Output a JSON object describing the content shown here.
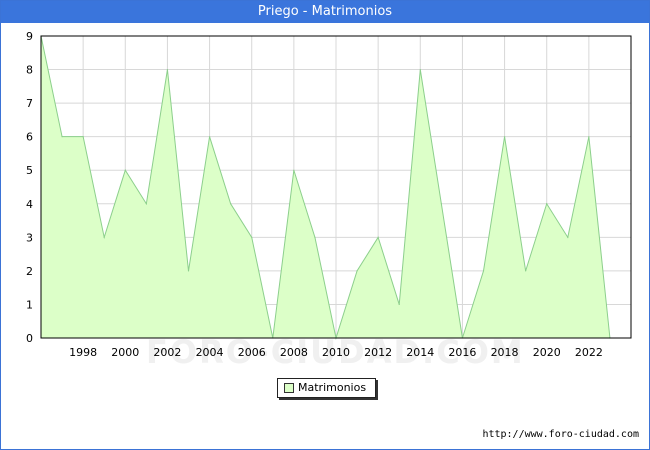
{
  "chart_data": {
    "type": "area",
    "title": "Priego - Matrimonios",
    "xlabel": "",
    "ylabel": "",
    "x": [
      1996,
      1997,
      1998,
      1999,
      2000,
      2001,
      2002,
      2003,
      2004,
      2005,
      2006,
      2007,
      2008,
      2009,
      2010,
      2011,
      2012,
      2013,
      2014,
      2015,
      2016,
      2017,
      2018,
      2019,
      2020,
      2021,
      2022,
      2023
    ],
    "series": [
      {
        "name": "Matrimonios",
        "values": [
          9,
          6,
          6,
          3,
          5,
          4,
          8,
          2,
          6,
          4,
          3,
          0,
          5,
          3,
          0,
          2,
          3,
          1,
          8,
          4,
          0,
          2,
          6,
          2,
          4,
          3,
          6,
          0
        ]
      }
    ],
    "xticks": [
      1998,
      2000,
      2002,
      2004,
      2006,
      2008,
      2010,
      2012,
      2014,
      2016,
      2018,
      2020,
      2022
    ],
    "yticks": [
      0,
      1,
      2,
      3,
      4,
      5,
      6,
      7,
      8,
      9
    ],
    "xlim": [
      1996,
      2024
    ],
    "ylim": [
      0,
      9
    ],
    "grid": true,
    "legend": "bottom-center",
    "colors": {
      "fill": "#dcffc8",
      "line": "#8ccf8c",
      "title_bar": "#3a75dc",
      "grid": "#d8d8d8"
    }
  },
  "legend_label": "Matrimonios",
  "footer_url": "http://www.foro-ciudad.com",
  "watermark": "FORO-CIUDAD.COM"
}
